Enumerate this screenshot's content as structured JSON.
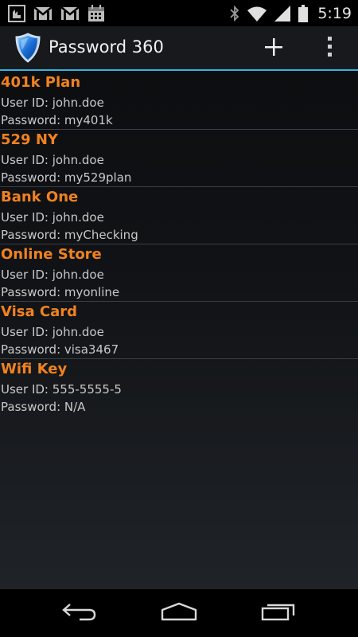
{
  "status_bar": {
    "time": "5:19",
    "left_icons": [
      "usb-debug-icon",
      "gmail-icon",
      "gmail-icon",
      "calendar-icon"
    ],
    "right_icons": [
      "bluetooth-icon",
      "wifi-icon",
      "signal-icon",
      "battery-icon"
    ]
  },
  "action_bar": {
    "title": "Password 360",
    "app_icon": "shield-icon",
    "actions": [
      "add-icon",
      "overflow-menu-icon"
    ]
  },
  "entries": [
    {
      "name": "401k Plan",
      "user": "User ID: john.doe",
      "password": "Password: my401k"
    },
    {
      "name": "529 NY",
      "user": "User ID: john.doe",
      "password": "Password: my529plan"
    },
    {
      "name": "Bank One",
      "user": "User ID: john.doe",
      "password": "Password: myChecking"
    },
    {
      "name": "Online Store",
      "user": "User ID: john.doe",
      "password": "Password: myonline"
    },
    {
      "name": "Visa Card",
      "user": "User ID: john.doe",
      "password": "Password: visa3467"
    },
    {
      "name": "Wifi Key",
      "user": "User ID: 555-5555-5",
      "password": "Password: N/A"
    }
  ],
  "nav_bar": {
    "buttons": [
      "back-icon",
      "home-icon",
      "recent-apps-icon"
    ]
  },
  "colors": {
    "accent": "#33b5e5",
    "entry_title": "#f08220",
    "entry_text": "#c8c8c8"
  }
}
